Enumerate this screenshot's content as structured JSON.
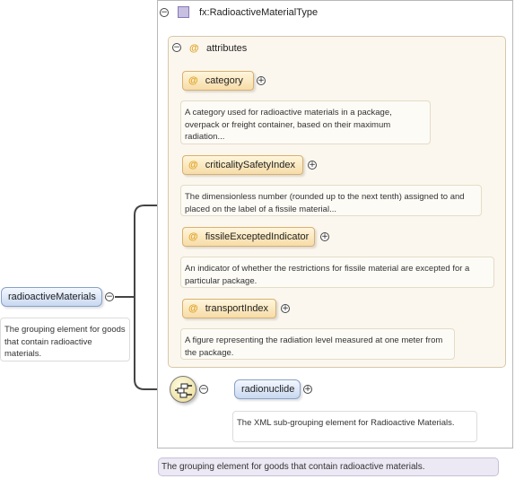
{
  "root": {
    "name": "radioactiveMaterials",
    "doc": "The grouping element for goods that contain radioactive materials."
  },
  "type": {
    "name": "fx:RadioactiveMaterialType",
    "doc": "The grouping element for goods that contain radioactive materials."
  },
  "attributes": {
    "title": "attributes",
    "symbol": "@",
    "items": [
      {
        "name": "category",
        "doc": "A category used for radioactive materials in a package, overpack or freight container, based on their maximum radiation..."
      },
      {
        "name": "criticalitySafetyIndex",
        "doc": "The dimensionless number (rounded up to the next tenth) assigned to and placed on the label of a fissile material..."
      },
      {
        "name": "fissileExceptedIndicator",
        "doc": "An indicator of whether the restrictions for fissile material are excepted for a particular package."
      },
      {
        "name": "transportIndex",
        "doc": "A figure representing the radiation level measured at one meter from the package."
      }
    ]
  },
  "child": {
    "name": "radionuclide",
    "doc": "The XML sub-grouping element for Radioactive Materials."
  },
  "icons": {
    "collapse": "minus-circle-icon",
    "expand": "plus-circle-icon",
    "type": "complex-type-icon",
    "sequence": "sequence-compositor-icon"
  }
}
